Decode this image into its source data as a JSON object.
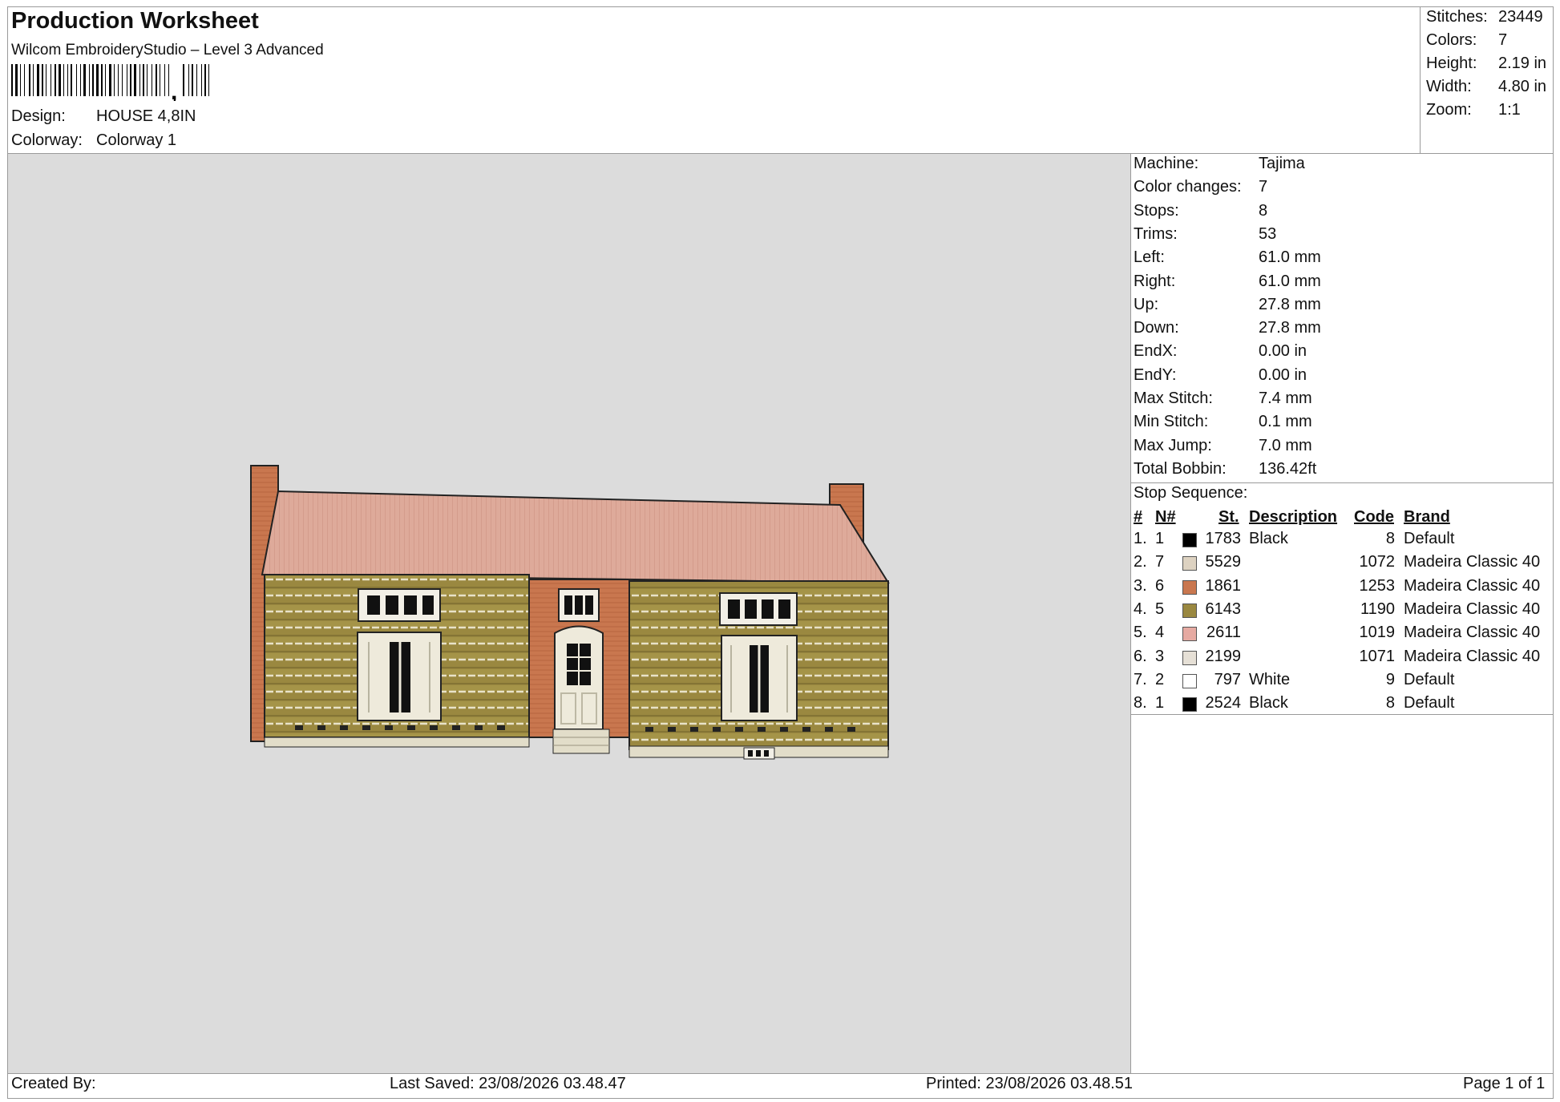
{
  "header": {
    "title": "Production Worksheet",
    "subtitle": "Wilcom EmbroideryStudio – Level 3 Advanced",
    "barcode_icon": "barcode-icon",
    "design_label": "Design:",
    "design_value": "HOUSE 4,8IN",
    "colorway_label": "Colorway:",
    "colorway_value": "Colorway 1"
  },
  "stats": [
    {
      "label": "Stitches:",
      "value": "23449"
    },
    {
      "label": "Colors:",
      "value": "7"
    },
    {
      "label": "Height:",
      "value": "2.19 in"
    },
    {
      "label": "Width:",
      "value": "4.80 in"
    },
    {
      "label": "Zoom:",
      "value": "1:1"
    }
  ],
  "machine_info": [
    {
      "label": "Machine:",
      "value": "Tajima"
    },
    {
      "label": "Color changes:",
      "value": "7"
    },
    {
      "label": "Stops:",
      "value": "8"
    },
    {
      "label": "Trims:",
      "value": "53"
    },
    {
      "label": "Left:",
      "value": "61.0 mm"
    },
    {
      "label": "Right:",
      "value": "61.0 mm"
    },
    {
      "label": "Up:",
      "value": "27.8 mm"
    },
    {
      "label": "Down:",
      "value": "27.8 mm"
    },
    {
      "label": "EndX:",
      "value": "0.00 in"
    },
    {
      "label": "EndY:",
      "value": "0.00 in"
    },
    {
      "label": "Max Stitch:",
      "value": "7.4 mm"
    },
    {
      "label": "Min Stitch:",
      "value": "0.1 mm"
    },
    {
      "label": "Max Jump:",
      "value": "7.0 mm"
    },
    {
      "label": "Total Bobbin:",
      "value": "136.42ft"
    }
  ],
  "stop_sequence": {
    "title": "Stop Sequence:",
    "headers": {
      "num": "#",
      "n": "N#",
      "st": "St.",
      "description": "Description",
      "code": "Code",
      "brand": "Brand"
    },
    "rows": [
      {
        "num": "1.",
        "n": "1",
        "color": "#000000",
        "st": "1783",
        "description": "Black",
        "code": "8",
        "brand": "Default"
      },
      {
        "num": "2.",
        "n": "7",
        "color": "#ddd2c1",
        "st": "5529",
        "description": "",
        "code": "1072",
        "brand": "Madeira Classic 40"
      },
      {
        "num": "3.",
        "n": "6",
        "color": "#c9774f",
        "st": "1861",
        "description": "",
        "code": "1253",
        "brand": "Madeira Classic 40"
      },
      {
        "num": "4.",
        "n": "5",
        "color": "#9a8840",
        "st": "6143",
        "description": "",
        "code": "1190",
        "brand": "Madeira Classic 40"
      },
      {
        "num": "5.",
        "n": "4",
        "color": "#e6aaa2",
        "st": "2611",
        "description": "",
        "code": "1019",
        "brand": "Madeira Classic 40"
      },
      {
        "num": "6.",
        "n": "3",
        "color": "#e6e0d6",
        "st": "2199",
        "description": "",
        "code": "1071",
        "brand": "Madeira Classic 40"
      },
      {
        "num": "7.",
        "n": "2",
        "color": "#ffffff",
        "st": "797",
        "description": "White",
        "code": "9",
        "brand": "Default"
      },
      {
        "num": "8.",
        "n": "1",
        "color": "#000000",
        "st": "2524",
        "description": "Black",
        "code": "8",
        "brand": "Default"
      }
    ]
  },
  "footer": {
    "created_by": "Created By:",
    "last_saved": "Last Saved: 23/08/2026 03.48.47",
    "printed": "Printed: 23/08/2026 03.48.51",
    "page": "Page 1 of 1"
  },
  "design_preview": {
    "icon": "house-embroidery-design"
  }
}
